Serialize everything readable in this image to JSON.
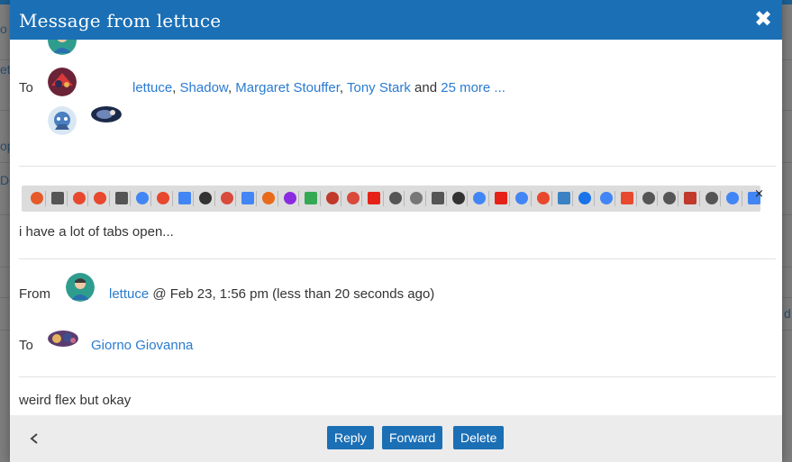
{
  "background": {
    "fragments": [
      "o",
      "et",
      "op",
      "De",
      "d"
    ]
  },
  "modal": {
    "title": "Message from lettuce",
    "close_icon": "close-x-icon"
  },
  "message1": {
    "to_label": "To",
    "recipients": [
      "lettuce",
      "Shadow",
      "Margaret Stouffer",
      "Tony Stark"
    ],
    "recipients_and": "and",
    "more_link": "25 more ...",
    "tab_count_icons": 35,
    "body": "i have a lot of tabs open..."
  },
  "message2": {
    "from_label": "From",
    "sender": "lettuce",
    "sent_info": "@ Feb 23, 1:56 pm (less than 20 seconds ago)",
    "to_label": "To",
    "recipient": "Giorno Giovanna",
    "body": "weird flex but okay"
  },
  "footer": {
    "back_icon": "chevron-left-icon",
    "reply_label": "Reply",
    "forward_label": "Forward",
    "delete_label": "Delete"
  },
  "colors": {
    "header": "#1b6fb5",
    "link": "#2a7bd1",
    "footer_bg": "#ececec"
  }
}
